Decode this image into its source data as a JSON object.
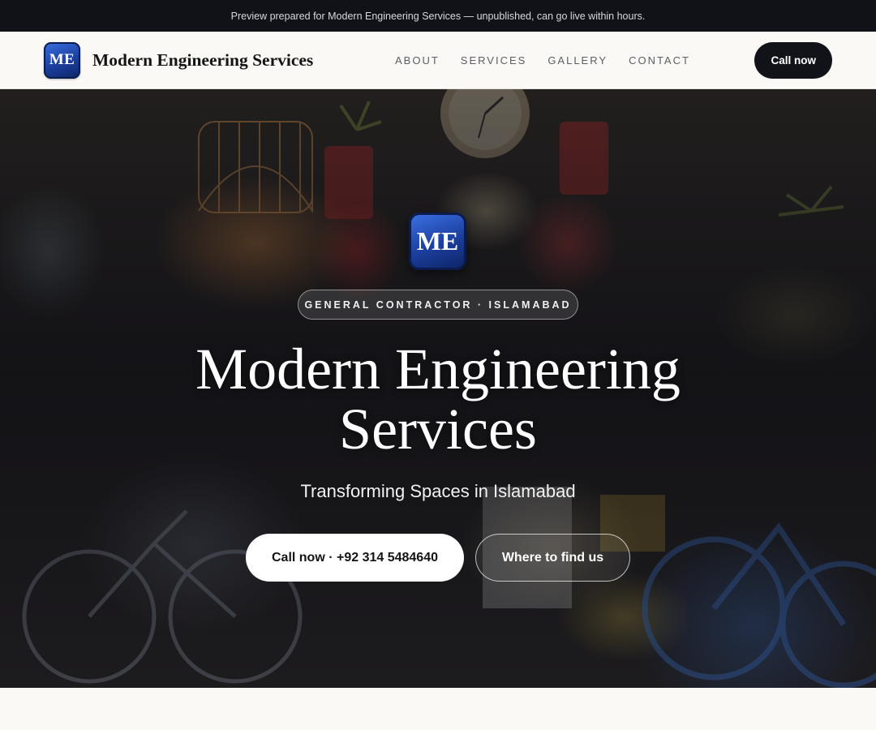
{
  "banner": {
    "text": "Preview prepared for Modern Engineering Services — unpublished, can go live within hours."
  },
  "header": {
    "logo_text": "ME",
    "brand_name": "Modern Engineering Services",
    "nav": [
      {
        "label": "ABOUT"
      },
      {
        "label": "SERVICES"
      },
      {
        "label": "GALLERY"
      },
      {
        "label": "CONTACT"
      }
    ],
    "cta_label": "Call now"
  },
  "hero": {
    "logo_text": "ME",
    "eyebrow": "GENERAL CONTRACTOR · ISLAMABAD",
    "title_line1": "Modern Engineering",
    "title_line2": "Services",
    "subtitle": "Transforming Spaces in Islamabad",
    "primary_button": "Call now · +92 314 5484640",
    "secondary_button": "Where to find us"
  },
  "colors": {
    "banner_bg": "#101218",
    "header_bg": "#fbf9f5",
    "cta_bg": "#121319",
    "logo_blue": "#1b3f9e"
  }
}
